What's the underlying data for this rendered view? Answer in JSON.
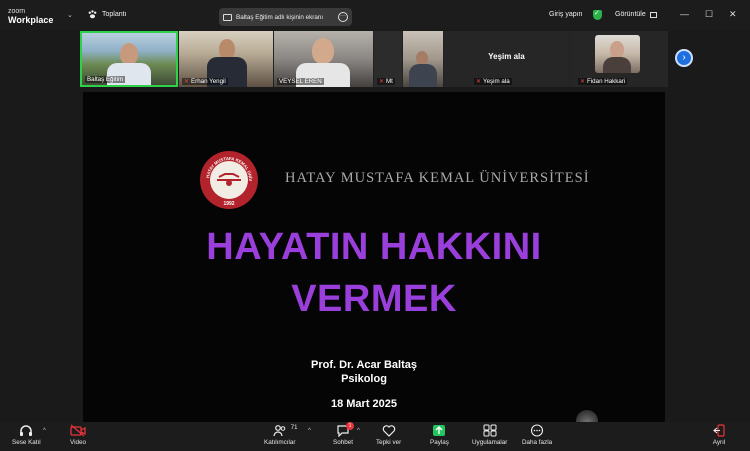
{
  "app": {
    "brand_small": "zoom",
    "brand_big": "Workplace"
  },
  "topbar": {
    "meeting_tab": "Toplantı",
    "share_label": "Baltaş Eğitim adlı kişinin ekranı",
    "signin": "Giriş yapın",
    "view": "Görüntüle",
    "window_controls": [
      "—",
      "☐",
      "✕"
    ]
  },
  "participants": [
    {
      "name": "Baltaş Eğitim",
      "muted": false,
      "active_speaker": true
    },
    {
      "name": "Erhan Yengil",
      "muted": true
    },
    {
      "name": "VEYSEL EREN",
      "muted": false
    },
    {
      "name": "Mt",
      "muted": true
    },
    {
      "name": "Yeşim ala",
      "muted": true,
      "display_text": "Yeşim ala"
    },
    {
      "name": "Fidan Hakkari",
      "muted": true
    }
  ],
  "screen": {
    "university": "HATAY MUSTAFA KEMAL ÜNİVERSİTESİ",
    "logo_text_top": "HATAY MUSTAFA KEMAL ÜNİVERSİTESİ",
    "logo_year": "1992",
    "title_line1": "HAYATIN HAKKINI",
    "title_line2": "VERMEK",
    "presenter": "Prof. Dr. Acar Baltaş",
    "role": "Psikolog",
    "date": "18 Mart 2025"
  },
  "toolbar": {
    "audio": "Sese Katıl",
    "video": "Video",
    "participants": "Katılımcılar",
    "participant_count": "71",
    "chat": "Sohbet",
    "chat_badge": "1",
    "react": "Tepki ver",
    "share": "Paylaş",
    "apps": "Uygulamalar",
    "more": "Daha fazla",
    "leave": "Ayrıl"
  },
  "colors": {
    "accent_green": "#2fd04a",
    "title_purple": "#9b3fdc",
    "share_green": "#22c55e",
    "leave_red": "#e5343b",
    "next_blue": "#1d6fe0"
  }
}
